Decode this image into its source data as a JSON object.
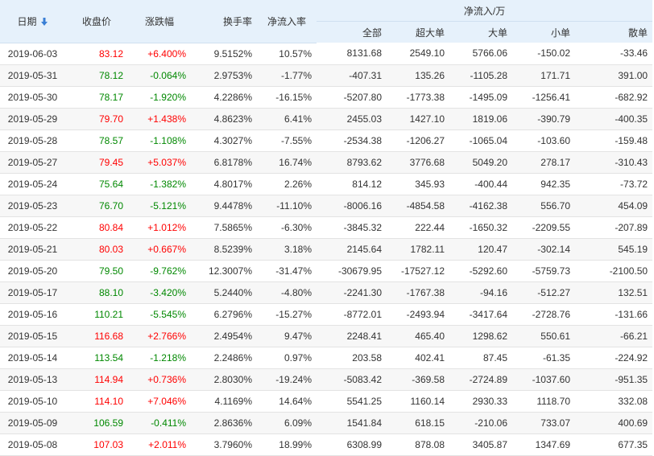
{
  "headers": {
    "date": "日期",
    "close": "收盘价",
    "change": "涨跌幅",
    "turnover": "换手率",
    "net_ratio": "净流入率",
    "net_inflow_group": "净流入/万",
    "all": "全部",
    "super_large": "超大单",
    "large": "大单",
    "small": "小单",
    "retail": "散单"
  },
  "sort_icon": "arrow-down-icon",
  "colors": {
    "up": "#ff0000",
    "down": "#008800",
    "header_bg": "#e6f1fb",
    "sort_arrow": "#3a7fd5"
  },
  "rows": [
    {
      "date": "2019-06-03",
      "close": "83.12",
      "change": "+6.400%",
      "turnover": "9.5152%",
      "net_ratio": "10.57%",
      "all": "8131.68",
      "super_large": "2549.10",
      "large": "5766.06",
      "small": "-150.02",
      "retail": "-33.46",
      "dir": "up"
    },
    {
      "date": "2019-05-31",
      "close": "78.12",
      "change": "-0.064%",
      "turnover": "2.9753%",
      "net_ratio": "-1.77%",
      "all": "-407.31",
      "super_large": "135.26",
      "large": "-1105.28",
      "small": "171.71",
      "retail": "391.00",
      "dir": "down"
    },
    {
      "date": "2019-05-30",
      "close": "78.17",
      "change": "-1.920%",
      "turnover": "4.2286%",
      "net_ratio": "-16.15%",
      "all": "-5207.80",
      "super_large": "-1773.38",
      "large": "-1495.09",
      "small": "-1256.41",
      "retail": "-682.92",
      "dir": "down"
    },
    {
      "date": "2019-05-29",
      "close": "79.70",
      "change": "+1.438%",
      "turnover": "4.8623%",
      "net_ratio": "6.41%",
      "all": "2455.03",
      "super_large": "1427.10",
      "large": "1819.06",
      "small": "-390.79",
      "retail": "-400.35",
      "dir": "up"
    },
    {
      "date": "2019-05-28",
      "close": "78.57",
      "change": "-1.108%",
      "turnover": "4.3027%",
      "net_ratio": "-7.55%",
      "all": "-2534.38",
      "super_large": "-1206.27",
      "large": "-1065.04",
      "small": "-103.60",
      "retail": "-159.48",
      "dir": "down"
    },
    {
      "date": "2019-05-27",
      "close": "79.45",
      "change": "+5.037%",
      "turnover": "6.8178%",
      "net_ratio": "16.74%",
      "all": "8793.62",
      "super_large": "3776.68",
      "large": "5049.20",
      "small": "278.17",
      "retail": "-310.43",
      "dir": "up"
    },
    {
      "date": "2019-05-24",
      "close": "75.64",
      "change": "-1.382%",
      "turnover": "4.8017%",
      "net_ratio": "2.26%",
      "all": "814.12",
      "super_large": "345.93",
      "large": "-400.44",
      "small": "942.35",
      "retail": "-73.72",
      "dir": "down"
    },
    {
      "date": "2019-05-23",
      "close": "76.70",
      "change": "-5.121%",
      "turnover": "9.4478%",
      "net_ratio": "-11.10%",
      "all": "-8006.16",
      "super_large": "-4854.58",
      "large": "-4162.38",
      "small": "556.70",
      "retail": "454.09",
      "dir": "down"
    },
    {
      "date": "2019-05-22",
      "close": "80.84",
      "change": "+1.012%",
      "turnover": "7.5865%",
      "net_ratio": "-6.30%",
      "all": "-3845.32",
      "super_large": "222.44",
      "large": "-1650.32",
      "small": "-2209.55",
      "retail": "-207.89",
      "dir": "up"
    },
    {
      "date": "2019-05-21",
      "close": "80.03",
      "change": "+0.667%",
      "turnover": "8.5239%",
      "net_ratio": "3.18%",
      "all": "2145.64",
      "super_large": "1782.11",
      "large": "120.47",
      "small": "-302.14",
      "retail": "545.19",
      "dir": "up"
    },
    {
      "date": "2019-05-20",
      "close": "79.50",
      "change": "-9.762%",
      "turnover": "12.3007%",
      "net_ratio": "-31.47%",
      "all": "-30679.95",
      "super_large": "-17527.12",
      "large": "-5292.60",
      "small": "-5759.73",
      "retail": "-2100.50",
      "dir": "down"
    },
    {
      "date": "2019-05-17",
      "close": "88.10",
      "change": "-3.420%",
      "turnover": "5.2440%",
      "net_ratio": "-4.80%",
      "all": "-2241.30",
      "super_large": "-1767.38",
      "large": "-94.16",
      "small": "-512.27",
      "retail": "132.51",
      "dir": "down"
    },
    {
      "date": "2019-05-16",
      "close": "110.21",
      "change": "-5.545%",
      "turnover": "6.2796%",
      "net_ratio": "-15.27%",
      "all": "-8772.01",
      "super_large": "-2493.94",
      "large": "-3417.64",
      "small": "-2728.76",
      "retail": "-131.66",
      "dir": "down"
    },
    {
      "date": "2019-05-15",
      "close": "116.68",
      "change": "+2.766%",
      "turnover": "2.4954%",
      "net_ratio": "9.47%",
      "all": "2248.41",
      "super_large": "465.40",
      "large": "1298.62",
      "small": "550.61",
      "retail": "-66.21",
      "dir": "up"
    },
    {
      "date": "2019-05-14",
      "close": "113.54",
      "change": "-1.218%",
      "turnover": "2.2486%",
      "net_ratio": "0.97%",
      "all": "203.58",
      "super_large": "402.41",
      "large": "87.45",
      "small": "-61.35",
      "retail": "-224.92",
      "dir": "down"
    },
    {
      "date": "2019-05-13",
      "close": "114.94",
      "change": "+0.736%",
      "turnover": "2.8030%",
      "net_ratio": "-19.24%",
      "all": "-5083.42",
      "super_large": "-369.58",
      "large": "-2724.89",
      "small": "-1037.60",
      "retail": "-951.35",
      "dir": "up"
    },
    {
      "date": "2019-05-10",
      "close": "114.10",
      "change": "+7.046%",
      "turnover": "4.1169%",
      "net_ratio": "14.64%",
      "all": "5541.25",
      "super_large": "1160.14",
      "large": "2930.33",
      "small": "1118.70",
      "retail": "332.08",
      "dir": "up"
    },
    {
      "date": "2019-05-09",
      "close": "106.59",
      "change": "-0.411%",
      "turnover": "2.8636%",
      "net_ratio": "6.09%",
      "all": "1541.84",
      "super_large": "618.15",
      "large": "-210.06",
      "small": "733.07",
      "retail": "400.69",
      "dir": "down"
    },
    {
      "date": "2019-05-08",
      "close": "107.03",
      "change": "+2.011%",
      "turnover": "3.7960%",
      "net_ratio": "18.99%",
      "all": "6308.99",
      "super_large": "878.08",
      "large": "3405.87",
      "small": "1347.69",
      "retail": "677.35",
      "dir": "up"
    }
  ]
}
